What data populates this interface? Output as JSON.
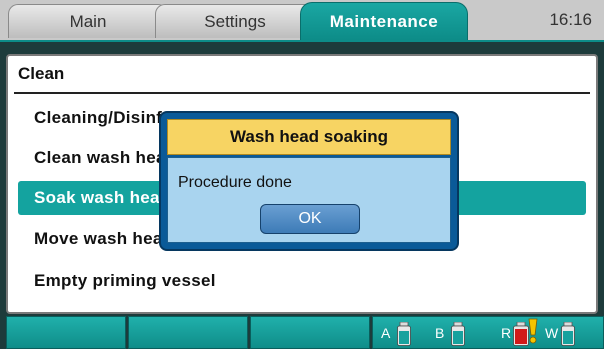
{
  "tabs": [
    {
      "label": "Main",
      "active": false
    },
    {
      "label": "Settings",
      "active": false
    },
    {
      "label": "Maintenance",
      "active": true
    }
  ],
  "clock": "16:16",
  "section": {
    "title": "Clean",
    "items": [
      {
        "label": "Cleaning/Disinfection procedures",
        "selected": false
      },
      {
        "label": "Clean wash head",
        "selected": false
      },
      {
        "label": "Soak wash head",
        "selected": true
      },
      {
        "label": "Move wash head",
        "selected": false
      },
      {
        "label": "Empty priming vessel",
        "selected": false
      }
    ]
  },
  "dialog": {
    "title": "Wash head soaking",
    "message": "Procedure done",
    "ok_label": "OK"
  },
  "status": {
    "bottles": [
      {
        "label": "A",
        "icon": "bottle-icon",
        "state": "ok"
      },
      {
        "label": "B",
        "icon": "bottle-icon",
        "state": "ok"
      },
      {
        "label": "R",
        "icon": "bottle-icon",
        "state": "warning"
      },
      {
        "label": "W",
        "icon": "bottle-icon",
        "state": "ok"
      }
    ],
    "colors": {
      "accent": "#14a39f",
      "warning": "#d11a1a",
      "alert": "#f4c400"
    }
  }
}
